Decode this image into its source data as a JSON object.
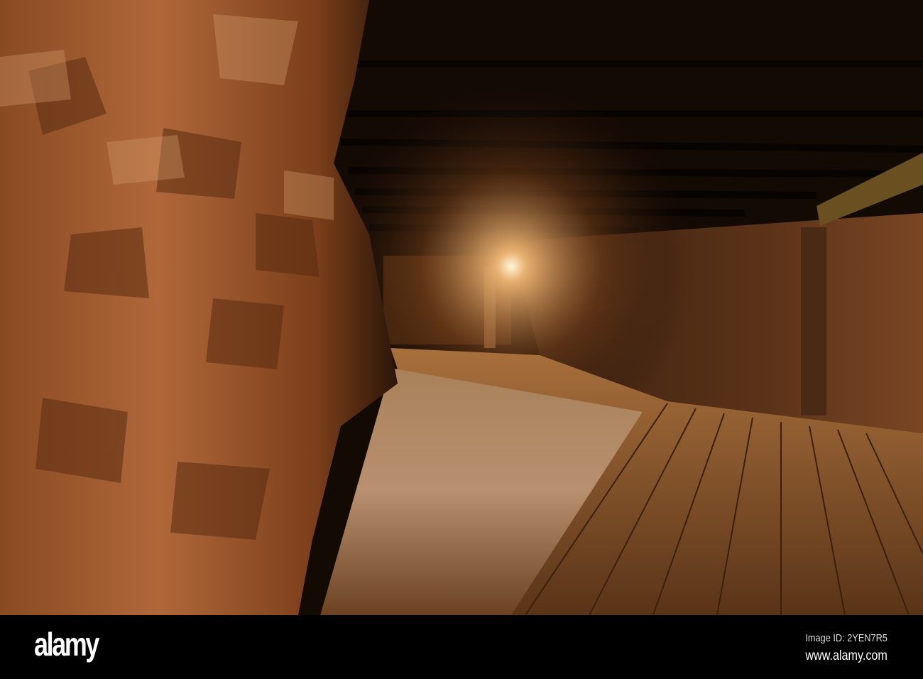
{
  "photo": {
    "subject": "Underground mine tunnel with rocky walls, wooden beam ceiling and wooden boardwalk",
    "watermark": "alamy"
  },
  "footer": {
    "logo": "alamy",
    "image_id": "Image ID: 2YEN7R5",
    "website": "www.alamy.com"
  }
}
